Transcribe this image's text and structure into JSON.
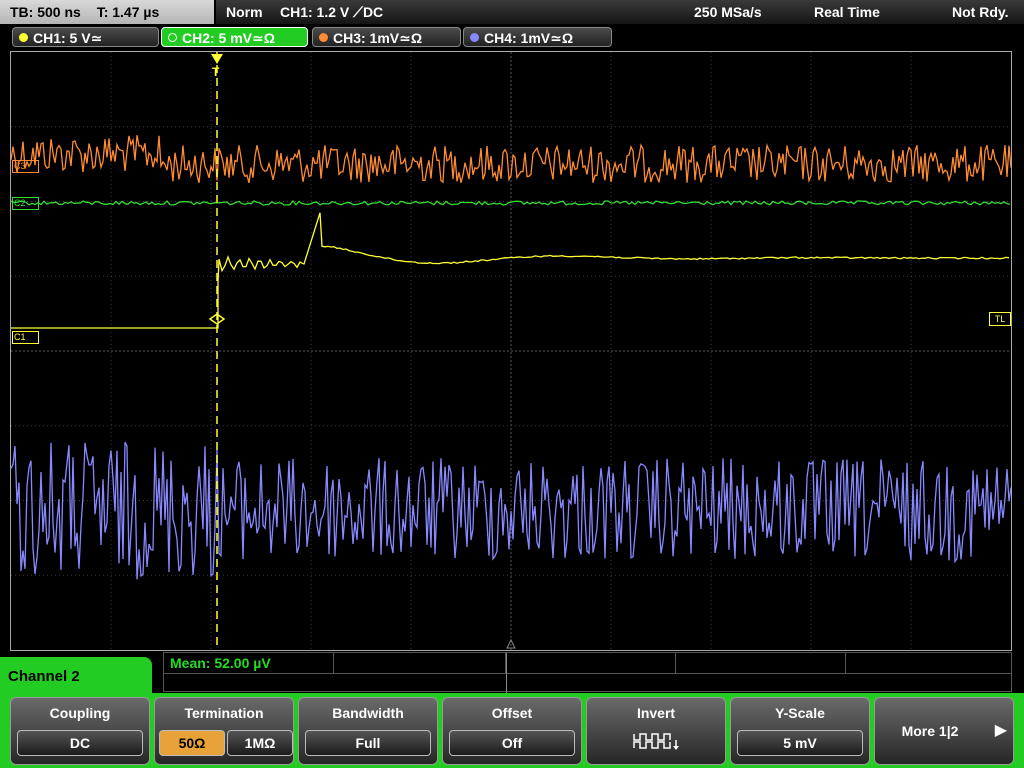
{
  "topbar": {
    "timebase": "TB: 500 ns",
    "trigger_time": "T: 1.47 µs",
    "mode": "Norm",
    "trigger_setting": "CH1: 1.2 V ⟋DC",
    "sample_rate": "250 MSa/s",
    "acquisition": "Real Time",
    "trigger_status": "Not Rdy."
  },
  "channels": [
    {
      "label": "CH1: 5 V≃",
      "color": "#ffff33"
    },
    {
      "label": "CH2: 5 mV≃Ω",
      "color": "#33dd33"
    },
    {
      "label": "CH3: 1mV≃Ω",
      "color": "#ff8c33"
    },
    {
      "label": "CH4: 1mV≃Ω",
      "color": "#8888ff"
    }
  ],
  "markers": {
    "c3": "C3",
    "c2": "C2",
    "c1": "C1",
    "trigger_level": "TL",
    "trigger_pos": "T"
  },
  "measurement": {
    "text": "Mean: 52.00 µV"
  },
  "menu": {
    "title": "Channel 2",
    "softkeys": [
      {
        "label": "Coupling",
        "value": "DC"
      },
      {
        "label": "Termination",
        "options": [
          "50Ω",
          "1MΩ"
        ],
        "selected": "50Ω"
      },
      {
        "label": "Bandwidth",
        "value": "Full"
      },
      {
        "label": "Offset",
        "value": "Off"
      },
      {
        "label": "Invert",
        "icon": "invert-waveform-icon"
      },
      {
        "label": "Y-Scale",
        "value": "5 mV"
      }
    ],
    "more": "More 1|2"
  }
}
